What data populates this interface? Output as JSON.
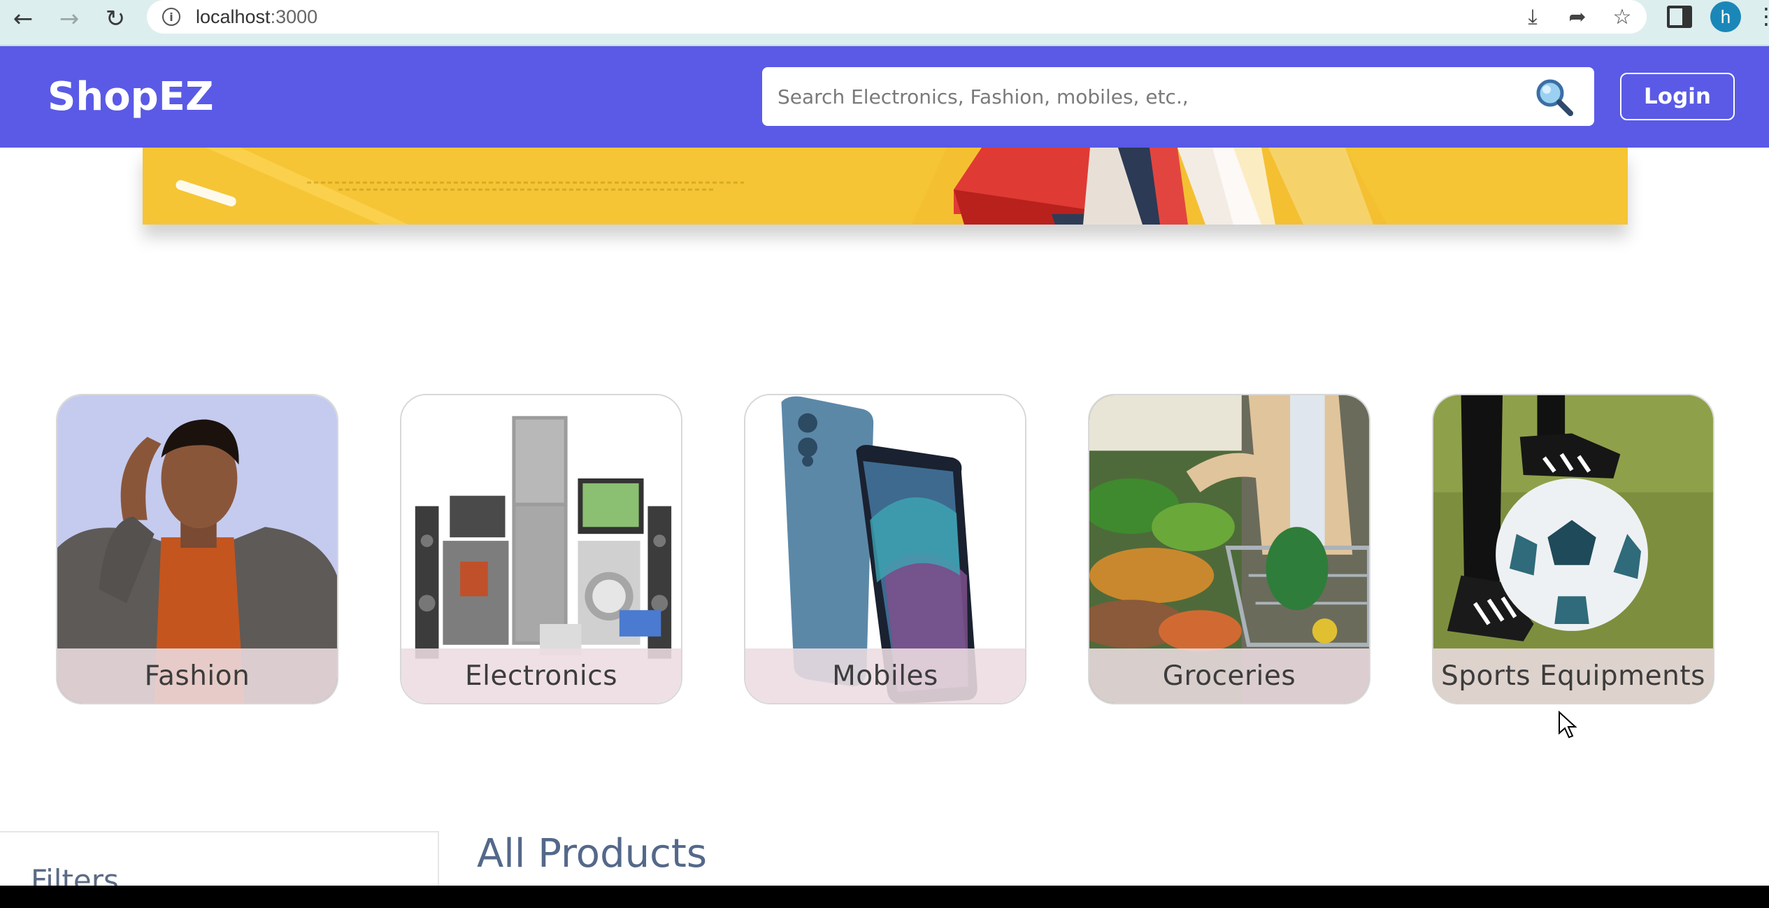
{
  "browser": {
    "url_host": "localhost",
    "url_port": ":3000",
    "profile_initial": "h"
  },
  "navbar": {
    "brand": "ShopEZ",
    "search_placeholder": "Search Electronics, Fashion, mobiles, etc.,",
    "login_label": "Login",
    "background_color": "#5a5ae6"
  },
  "categories": [
    {
      "label": "Fashion"
    },
    {
      "label": "Electronics"
    },
    {
      "label": "Mobiles"
    },
    {
      "label": "Groceries"
    },
    {
      "label": "Sports Equipments"
    }
  ],
  "filters": {
    "title": "Filters"
  },
  "products": {
    "title": "All Products"
  }
}
